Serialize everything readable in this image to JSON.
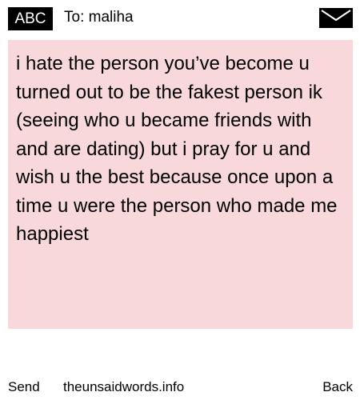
{
  "header": {
    "badge": "ABC",
    "to_line": "To: maliha",
    "mail_icon": "envelope-icon"
  },
  "message": {
    "text": "i hate the person you’ve become u turned out to be the fakest person ik (seeing who u became friends with and are dating) but i pray for u and wish u the best because once upon a time u were the person who made me happiest"
  },
  "footer": {
    "send": "Send",
    "site": "theunsaidwords.info",
    "back": "Back"
  },
  "colors": {
    "message_background": "#f9d8dc",
    "badge_background": "#000000",
    "badge_text": "#ffffff"
  }
}
